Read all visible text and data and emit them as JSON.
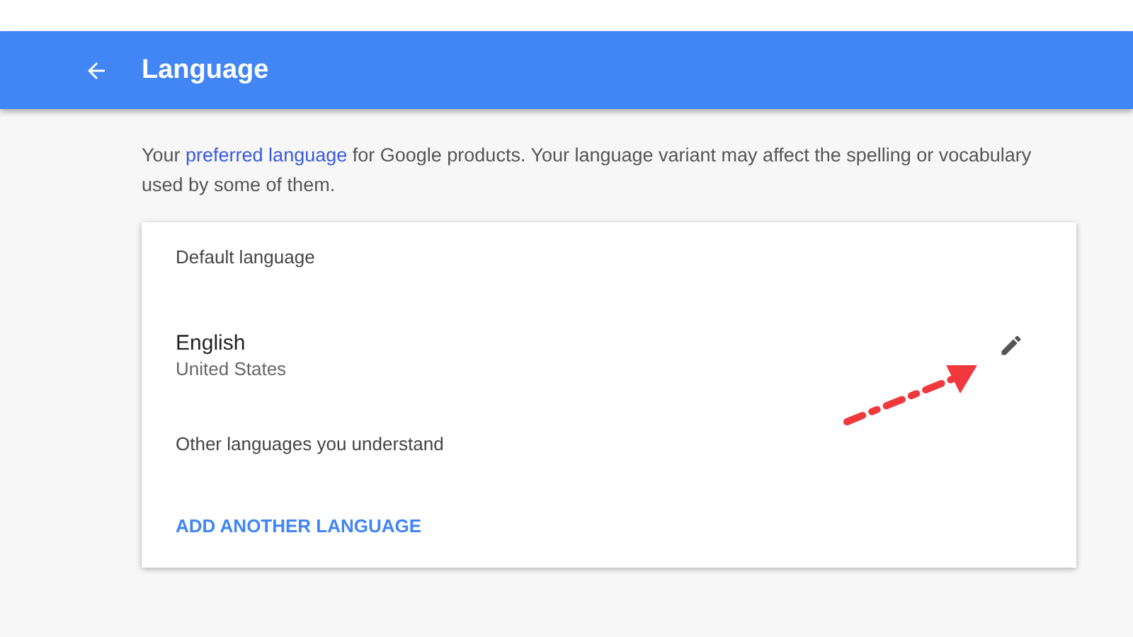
{
  "header": {
    "title": "Language"
  },
  "intro": {
    "before": "Your ",
    "link": "preferred language",
    "after": " for Google products. Your language variant may affect the spelling or vocabulary used by some of them."
  },
  "card": {
    "default_heading": "Default language",
    "default_language": {
      "name": "English",
      "region": "United States"
    },
    "other_heading": "Other languages you understand",
    "add_button": "ADD ANOTHER LANGUAGE"
  }
}
